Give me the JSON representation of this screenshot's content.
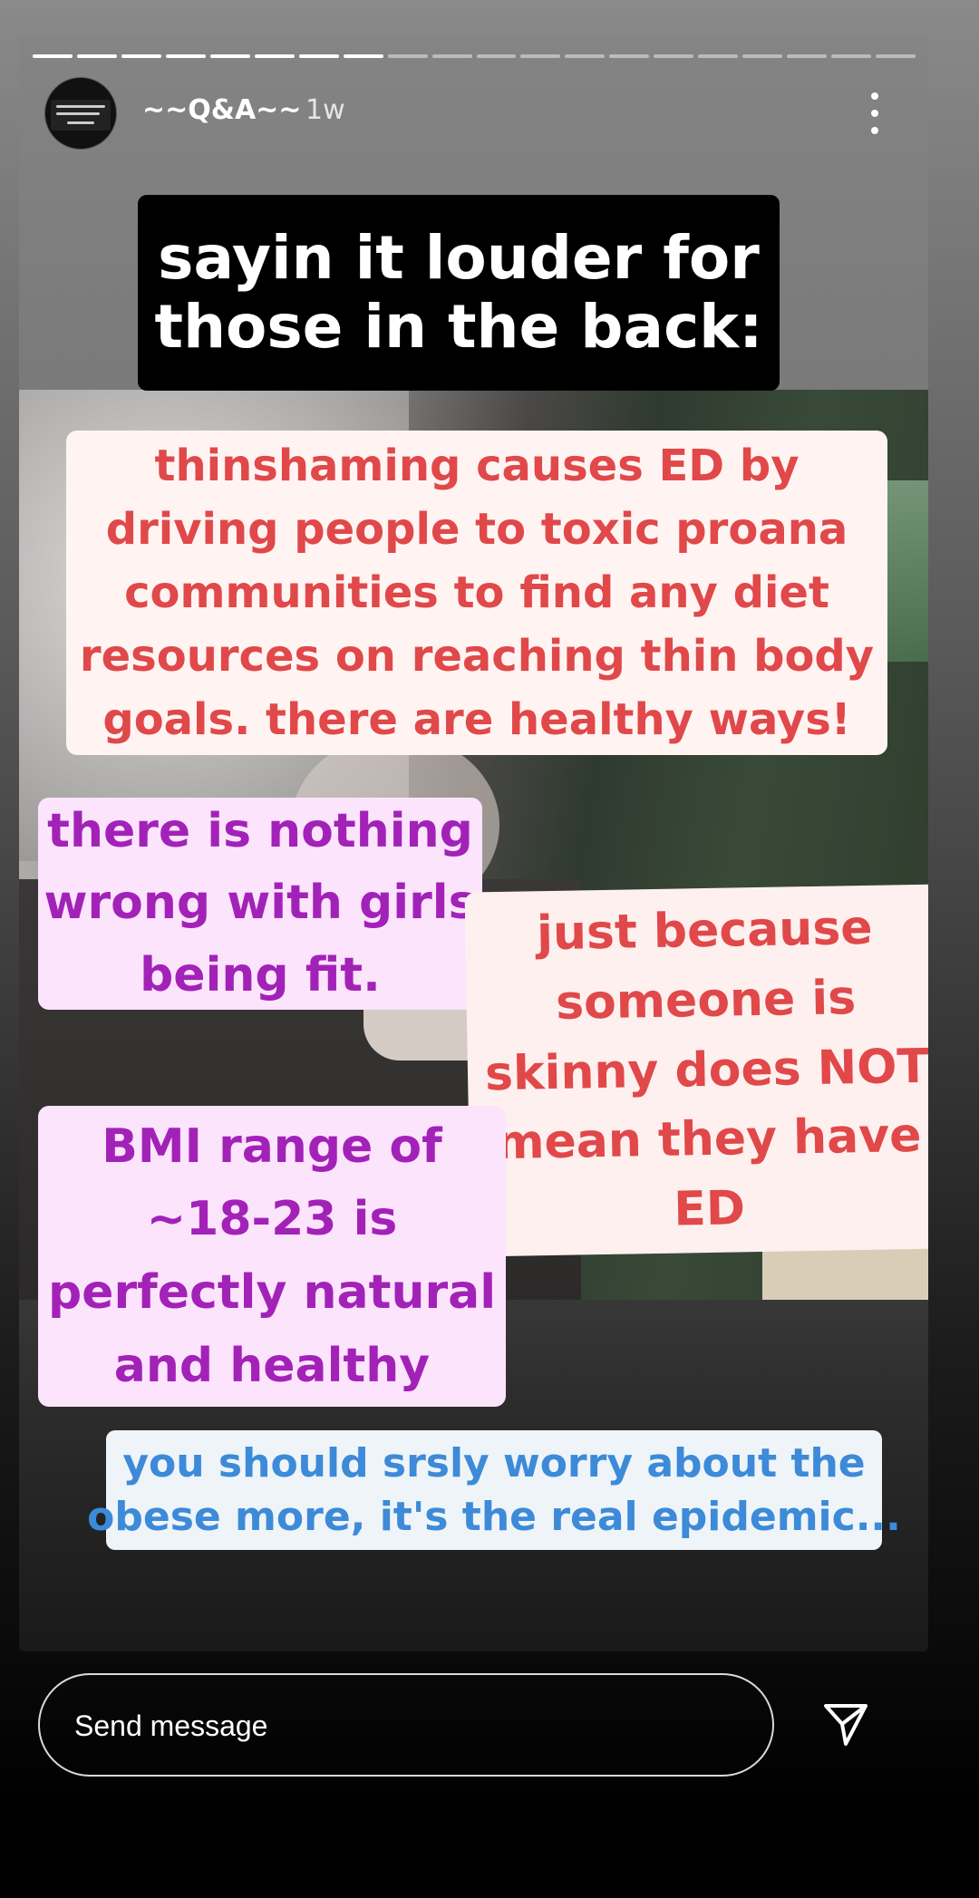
{
  "story": {
    "progress_total": 20,
    "progress_done": 8
  },
  "header": {
    "username": "~~Q&A~~",
    "time": "1w",
    "avatar_text": "ASK SAYA ANYTHING — WELLNESS Q&A —"
  },
  "stickers": {
    "headline": [
      "sayin it louder for",
      "those in the back:"
    ],
    "thinshaming": [
      "thinshaming causes ED by",
      "driving people to toxic proana",
      "communities to find any diet",
      "resources on reaching thin body",
      "goals. there are healthy ways!"
    ],
    "nothing_wrong": [
      "there is nothing",
      "wrong with girls",
      "being fit."
    ],
    "skinny": [
      "just because",
      "someone is",
      "skinny does NOT",
      "mean they have",
      "ED"
    ],
    "bmi": [
      "BMI range of",
      "~18-23 is",
      "perfectly natural",
      "and healthy"
    ],
    "obese": [
      "you should srsly worry about the",
      "obese more, it's the real epidemic..."
    ]
  },
  "footer": {
    "message_placeholder": "Send message"
  },
  "icons": {
    "more": "more-vertical-icon",
    "send": "send-paper-plane-icon"
  },
  "colors": {
    "red_text": "#e0484a",
    "purple_text": "#a222b8",
    "blue_text": "#3d8ad8"
  }
}
